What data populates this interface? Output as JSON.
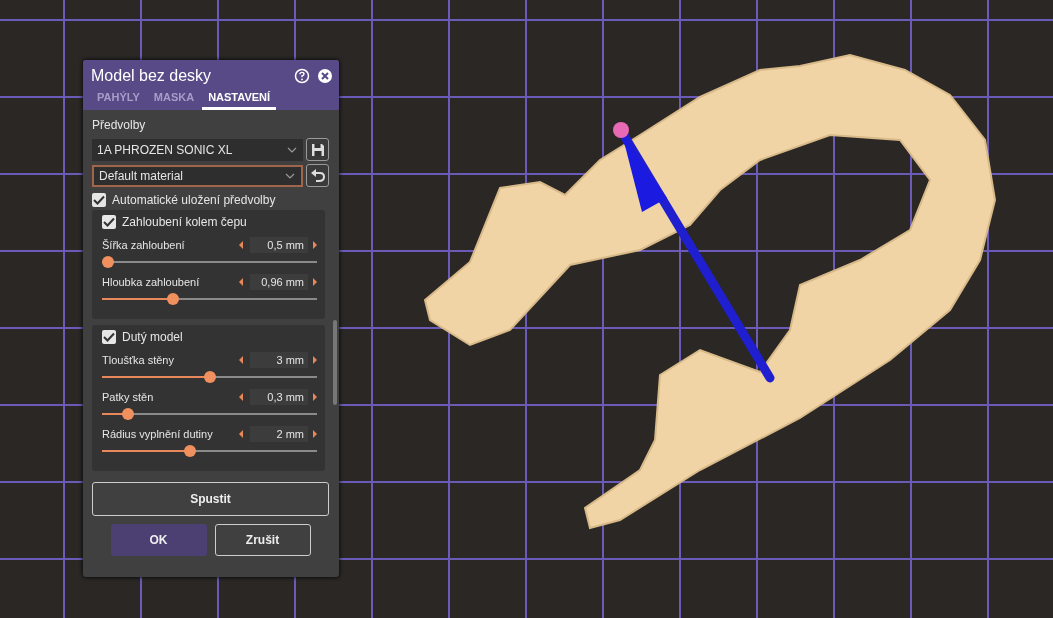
{
  "dialog": {
    "title": "Model bez desky",
    "tabs": [
      {
        "label": "PAHÝLY",
        "selected": false
      },
      {
        "label": "MASKA",
        "selected": false
      },
      {
        "label": "NASTAVENÍ",
        "selected": true
      }
    ],
    "presets_label": "Předvolby",
    "preset": {
      "value": "1A PHROZEN SONIC XL"
    },
    "material": {
      "value": "Default material"
    },
    "auto_save": {
      "label": "Automatické uložení předvolby",
      "checked": true
    },
    "groups": [
      {
        "label": "Zahloubení kolem čepu",
        "checked": true,
        "params": [
          {
            "label": "Šířka zahloubení",
            "value": "0,5 mm",
            "level": 0.03
          },
          {
            "label": "Hloubka zahloubení",
            "value": "0,96 mm",
            "level": 0.33
          }
        ]
      },
      {
        "label": "Dutý model",
        "checked": true,
        "params": [
          {
            "label": "Tloušťka stěny",
            "value": "3 mm",
            "level": 0.5
          },
          {
            "label": "Patky stěn",
            "value": "0,3 mm",
            "level": 0.12
          },
          {
            "label": "Rádius vyplnění dutiny",
            "value": "2 mm",
            "level": 0.41
          }
        ]
      }
    ],
    "run_button": "Spustit",
    "ok_button": "OK",
    "cancel_button": "Zrušit"
  }
}
